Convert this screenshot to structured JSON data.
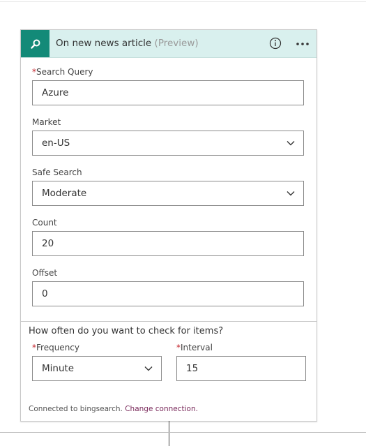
{
  "header": {
    "icon": "search-icon",
    "title": "On new news article",
    "preview": "(Preview)",
    "info_icon": "info-icon",
    "more_icon": "more-options-icon"
  },
  "fields": {
    "search_query": {
      "required_mark": "*",
      "label": "Search Query",
      "value": "Azure"
    },
    "market": {
      "label": "Market",
      "value": "en-US"
    },
    "safe_search": {
      "label": "Safe Search",
      "value": "Moderate"
    },
    "count": {
      "label": "Count",
      "value": "20"
    },
    "offset": {
      "label": "Offset",
      "value": "0"
    }
  },
  "recurrence": {
    "question": "How often do you want to check for items?",
    "frequency": {
      "required_mark": "*",
      "label": "Frequency",
      "value": "Minute"
    },
    "interval": {
      "required_mark": "*",
      "label": "Interval",
      "value": "15"
    }
  },
  "footer": {
    "connected_text": "Connected to bingsearch.",
    "change_link": "Change connection."
  },
  "colors": {
    "header_bg": "#d9f0ee",
    "icon_bg": "#138a78",
    "required": "#c4262e",
    "link": "#7a2a5b"
  }
}
